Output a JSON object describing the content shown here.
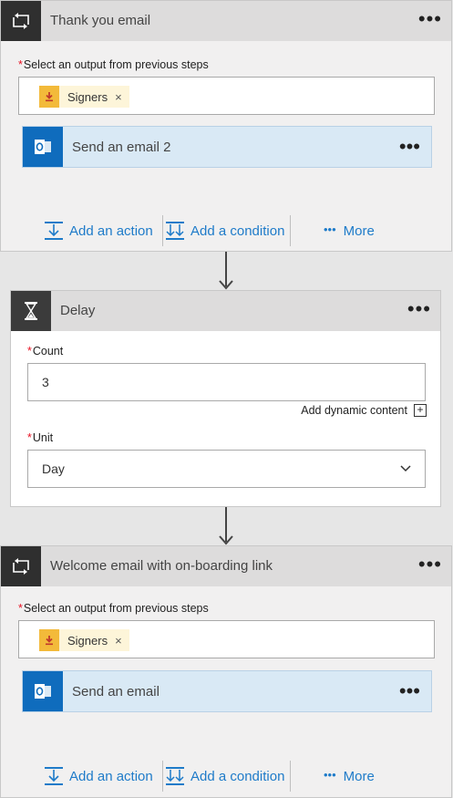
{
  "card1": {
    "title": "Thank you email",
    "more": "•••",
    "output_label": "Select an output from previous steps",
    "required_mark": "*",
    "token_label": "Signers",
    "token_remove": "×",
    "email_title": "Send an email 2",
    "email_more": "•••",
    "add_action": "Add an action",
    "add_condition": "Add a condition",
    "more_dots": "•••",
    "more_label": "More"
  },
  "delay": {
    "title": "Delay",
    "more": "•••",
    "count_label": "Count",
    "count_value": "3",
    "dynamic_content": "Add dynamic content",
    "plus": "+",
    "unit_label": "Unit",
    "unit_value": "Day",
    "required_mark": "*"
  },
  "card2": {
    "title": "Welcome email with on-boarding link",
    "more": "•••",
    "output_label": "Select an output from previous steps",
    "required_mark": "*",
    "token_label": "Signers",
    "token_remove": "×",
    "email_title": "Send an email",
    "email_more": "•••",
    "add_action": "Add an action",
    "add_condition": "Add a condition",
    "more_dots": "•••",
    "more_label": "More"
  },
  "colors": {
    "accent": "#1e7bc9",
    "header_icon_bg": "#2f2f2f",
    "outlook_blue": "#0f6cbd",
    "token_icon": "#f3ba3a",
    "required": "#e81123"
  },
  "icons": {
    "loop": "loop-icon",
    "hourglass": "hourglass-icon",
    "download": "download-icon",
    "outlook": "outlook-icon",
    "add_action": "add-action-icon",
    "add_condition": "add-condition-icon",
    "chevron": "chevron-down-icon"
  }
}
